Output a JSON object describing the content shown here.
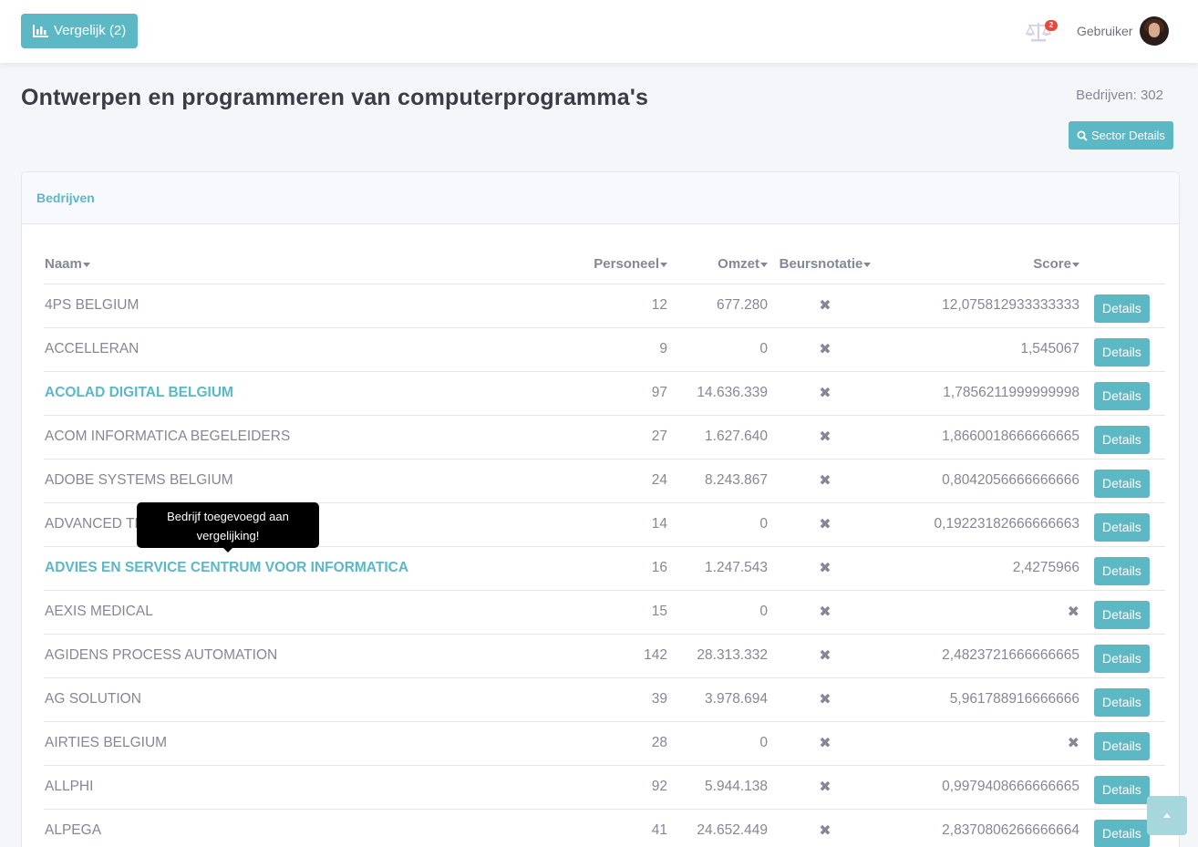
{
  "topbar": {
    "compare_label": "Vergelijk (2)",
    "compare_icon": "bar-chart-icon",
    "scale_icon": "balance-scale-icon",
    "scale_badge": "2",
    "user_name": "Gebruiker"
  },
  "page": {
    "title": "Ontwerpen en programmeren van computerprogramma's",
    "company_count": "Bedrijven: 302",
    "sector_button": "Sector Details"
  },
  "card": {
    "header": "Bedrijven",
    "columns": {
      "name": "Naam",
      "personeel": "Personeel",
      "omzet": "Omzet",
      "beursnotatie": "Beursnotatie",
      "score": "Score"
    },
    "details_label": "Details",
    "rows": [
      {
        "name": "4PS BELGIUM",
        "personeel": "12",
        "omzet": "677.280",
        "beurs": "✖",
        "score": "12,075812933333333",
        "link": false
      },
      {
        "name": "ACCELLERAN",
        "personeel": "9",
        "omzet": "0",
        "beurs": "✖",
        "score": "1,545067",
        "link": false
      },
      {
        "name": "ACOLAD DIGITAL BELGIUM",
        "personeel": "97",
        "omzet": "14.636.339",
        "beurs": "✖",
        "score": "1,7856211999999998",
        "link": true
      },
      {
        "name": "ACOM INFORMATICA BEGELEIDERS",
        "personeel": "27",
        "omzet": "1.627.640",
        "beurs": "✖",
        "score": "1,8660018666666665",
        "link": false
      },
      {
        "name": "ADOBE SYSTEMS BELGIUM",
        "personeel": "24",
        "omzet": "8.243.867",
        "beurs": "✖",
        "score": "0,8042056666666666",
        "link": false
      },
      {
        "name": "ADVANCED TECHNOLOGY SOLUTIONS",
        "personeel": "14",
        "omzet": "0",
        "beurs": "✖",
        "score": "0,19223182666666663",
        "link": false
      },
      {
        "name": "ADVIES EN SERVICE CENTRUM VOOR INFORMATICA",
        "personeel": "16",
        "omzet": "1.247.543",
        "beurs": "✖",
        "score": "2,4275966",
        "link": true
      },
      {
        "name": "AEXIS MEDICAL",
        "personeel": "15",
        "omzet": "0",
        "beurs": "✖",
        "score": "✖",
        "link": false
      },
      {
        "name": "AGIDENS PROCESS AUTOMATION",
        "personeel": "142",
        "omzet": "28.313.332",
        "beurs": "✖",
        "score": "2,4823721666666665",
        "link": false
      },
      {
        "name": "AG SOLUTION",
        "personeel": "39",
        "omzet": "3.978.694",
        "beurs": "✖",
        "score": "5,961788916666666",
        "link": false
      },
      {
        "name": "AIRTIES BELGIUM",
        "personeel": "28",
        "omzet": "0",
        "beurs": "✖",
        "score": "✖",
        "link": false
      },
      {
        "name": "ALLPHI",
        "personeel": "92",
        "omzet": "5.944.138",
        "beurs": "✖",
        "score": "0,9979408666666665",
        "link": false
      },
      {
        "name": "ALPEGA",
        "personeel": "41",
        "omzet": "24.652.449",
        "beurs": "✖",
        "score": "2,8370806266666664",
        "link": false
      }
    ]
  },
  "tooltip": {
    "text": "Bedrijf toegevoegd aan vergelijking!"
  },
  "colors": {
    "accent": "#5bb8c4",
    "badge": "#e74a3b",
    "text": "#858796",
    "title": "#3a3b45"
  }
}
